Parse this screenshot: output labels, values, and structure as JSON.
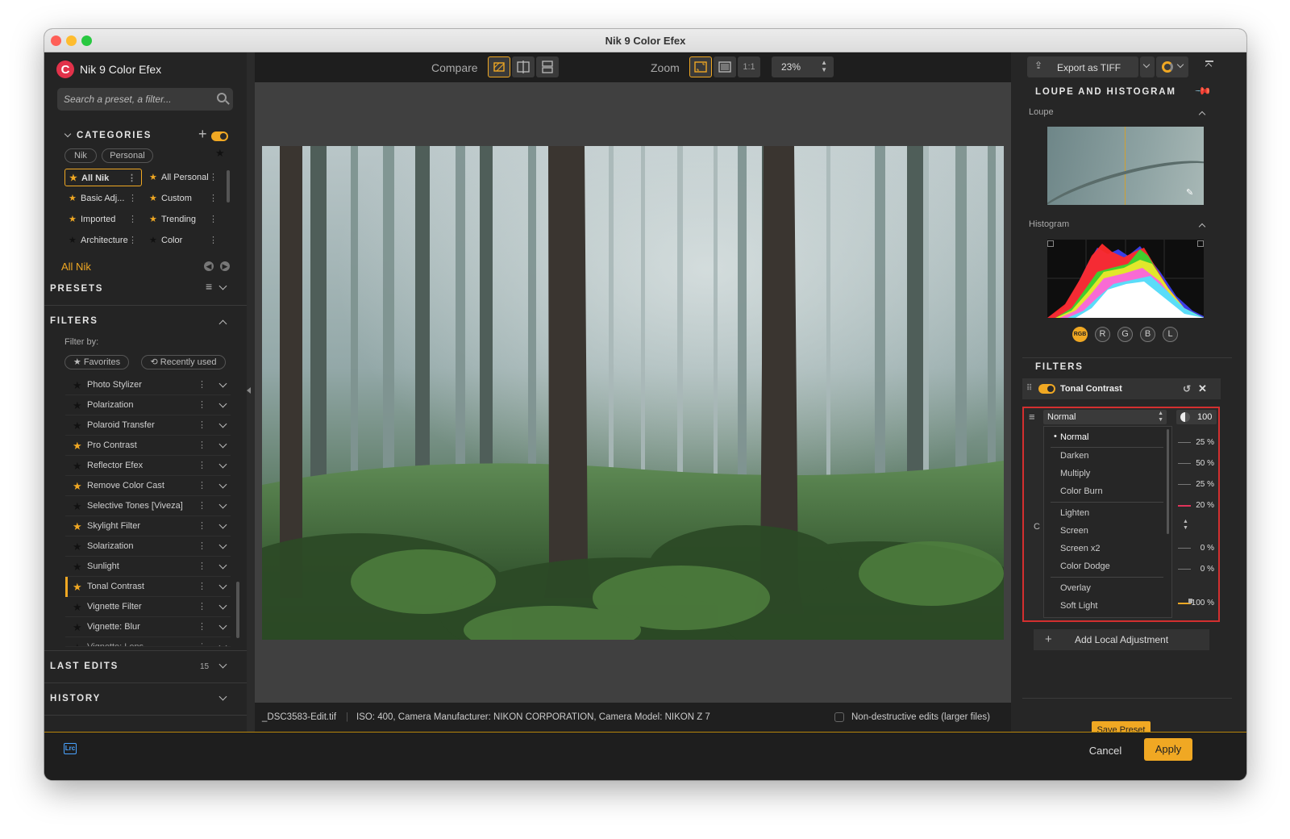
{
  "window": {
    "title": "Nik 9 Color Efex"
  },
  "app": {
    "name": "Nik 9 Color Efex",
    "logo_letter": "C"
  },
  "search": {
    "placeholder": "Search a preset, a filter..."
  },
  "categories": {
    "title": "CATEGORIES",
    "enabled": true,
    "source_tabs": [
      "Nik",
      "Personal"
    ],
    "items": [
      {
        "label": "All Nik",
        "selected": true,
        "starred": true
      },
      {
        "label": "All Personal",
        "selected": false,
        "starred": true
      },
      {
        "label": "Basic Adj...",
        "selected": false,
        "starred": true
      },
      {
        "label": "Custom",
        "selected": false,
        "starred": true
      },
      {
        "label": "Imported",
        "selected": false,
        "starred": true
      },
      {
        "label": "Trending",
        "selected": false,
        "starred": true
      },
      {
        "label": "Architecture",
        "selected": false,
        "starred": false
      },
      {
        "label": "Color",
        "selected": false,
        "starred": false
      }
    ],
    "current": "All Nik"
  },
  "presets": {
    "title": "PRESETS"
  },
  "filters_panel": {
    "title": "FILTERS",
    "filter_by_label": "Filter by:",
    "chips": [
      "Favorites",
      "Recently used"
    ],
    "items": [
      {
        "label": "Photo Stylizer",
        "favorite": false
      },
      {
        "label": "Polarization",
        "favorite": false
      },
      {
        "label": "Polaroid Transfer",
        "favorite": false
      },
      {
        "label": "Pro Contrast",
        "favorite": true
      },
      {
        "label": "Reflector Efex",
        "favorite": false
      },
      {
        "label": "Remove Color Cast",
        "favorite": true
      },
      {
        "label": "Selective Tones [Viveza]",
        "favorite": false
      },
      {
        "label": "Skylight Filter",
        "favorite": true
      },
      {
        "label": "Solarization",
        "favorite": false
      },
      {
        "label": "Sunlight",
        "favorite": false
      },
      {
        "label": "Tonal Contrast",
        "favorite": true,
        "selected": true
      },
      {
        "label": "Vignette Filter",
        "favorite": false
      },
      {
        "label": "Vignette: Blur",
        "favorite": false
      },
      {
        "label": "Vignette: Lens",
        "favorite": false
      }
    ]
  },
  "last_edits": {
    "title": "LAST EDITS",
    "count": "15"
  },
  "history": {
    "title": "HISTORY"
  },
  "toolbar": {
    "compare_label": "Compare",
    "zoom_label": "Zoom",
    "zoom_1to1": "1:1",
    "zoom_value": "23%"
  },
  "statusbar": {
    "filename": "_DSC3583-Edit.tif",
    "meta": "ISO: 400, Camera Manufacturer: NIKON CORPORATION, Camera Model: NIKON Z 7",
    "nondestructive_label": "Non-destructive edits (larger files)"
  },
  "right": {
    "export_label": "Export as TIFF",
    "loupe_section": "LOUPE AND HISTOGRAM",
    "loupe_label": "Loupe",
    "histogram_label": "Histogram",
    "channels": [
      "RGB",
      "R",
      "G",
      "B",
      "L"
    ],
    "filters_section": "FILTERS",
    "active_filter": "Tonal Contrast",
    "blend_mode": "Normal",
    "opacity": "100",
    "partial_label": "C",
    "blend_modes": [
      "Normal",
      "Darken",
      "Multiply",
      "Color Burn",
      "Lighten",
      "Screen",
      "Screen x2",
      "Color Dodge",
      "Overlay",
      "Soft Light"
    ],
    "slider_values": [
      "25 %",
      "50 %",
      "25 %",
      "20 %",
      "0 %",
      "0 %",
      "100 %"
    ],
    "add_local": "Add Local Adjustment",
    "save_preset": "Save Preset"
  },
  "bottom": {
    "lrc": "Lrc",
    "cancel": "Cancel",
    "apply": "Apply"
  },
  "colors": {
    "accent": "#f0a823",
    "highlight_box": "#d32f2f",
    "panel": "#242424"
  }
}
